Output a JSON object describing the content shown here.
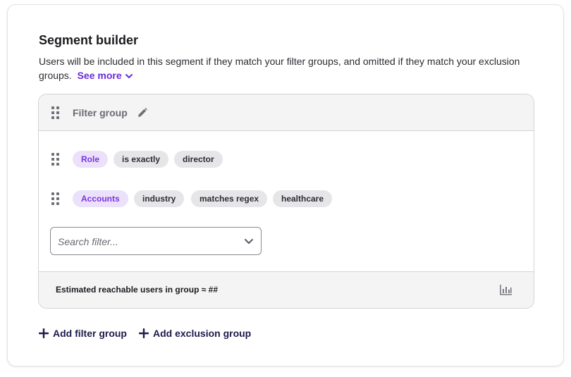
{
  "builder": {
    "title": "Segment builder",
    "description": "Users will be included in this segment if they match your filter groups, and omitted if they match your exclusion groups.",
    "see_more_label": "See more"
  },
  "filter_group": {
    "title": "Filter group",
    "rows": [
      {
        "chips": [
          "Role",
          "is exactly",
          "director"
        ]
      },
      {
        "chips": [
          "Accounts",
          "industry",
          "matches regex",
          "healthcare"
        ]
      }
    ],
    "search": {
      "placeholder": "Search filter..."
    },
    "footer_text": "Estimated reachable users in group ≈ ##"
  },
  "actions": {
    "add_filter_group": "Add filter group",
    "add_exclusion_group": "Add exclusion group"
  },
  "colors": {
    "accent_purple": "#6a2bd9",
    "chip_purple_bg": "#ece1fb",
    "chip_gray_bg": "#e6e6e8",
    "action_navy": "#1e1b4b"
  },
  "icons": [
    "drag-handle-icon",
    "pencil-icon",
    "chevron-down-icon",
    "bar-chart-icon",
    "plus-icon"
  ]
}
